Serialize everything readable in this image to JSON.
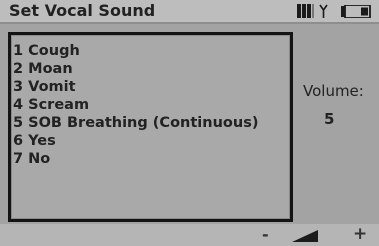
{
  "header": {
    "title": "Set Vocal Sound"
  },
  "status_icons": [
    "signal-bars-icon",
    "antenna-icon",
    "battery-icon"
  ],
  "sound_list": [
    "1 Cough",
    "2 Moan",
    "3 Vomit",
    "4 Scream",
    "5 SOB Breathing (Continuous)",
    "6 Yes",
    "7 No"
  ],
  "volume": {
    "label": "Volume:",
    "value": "5"
  },
  "footer": {
    "decrease_label": "-",
    "increase_label": "+",
    "level_icon": "volume-level-icon"
  }
}
